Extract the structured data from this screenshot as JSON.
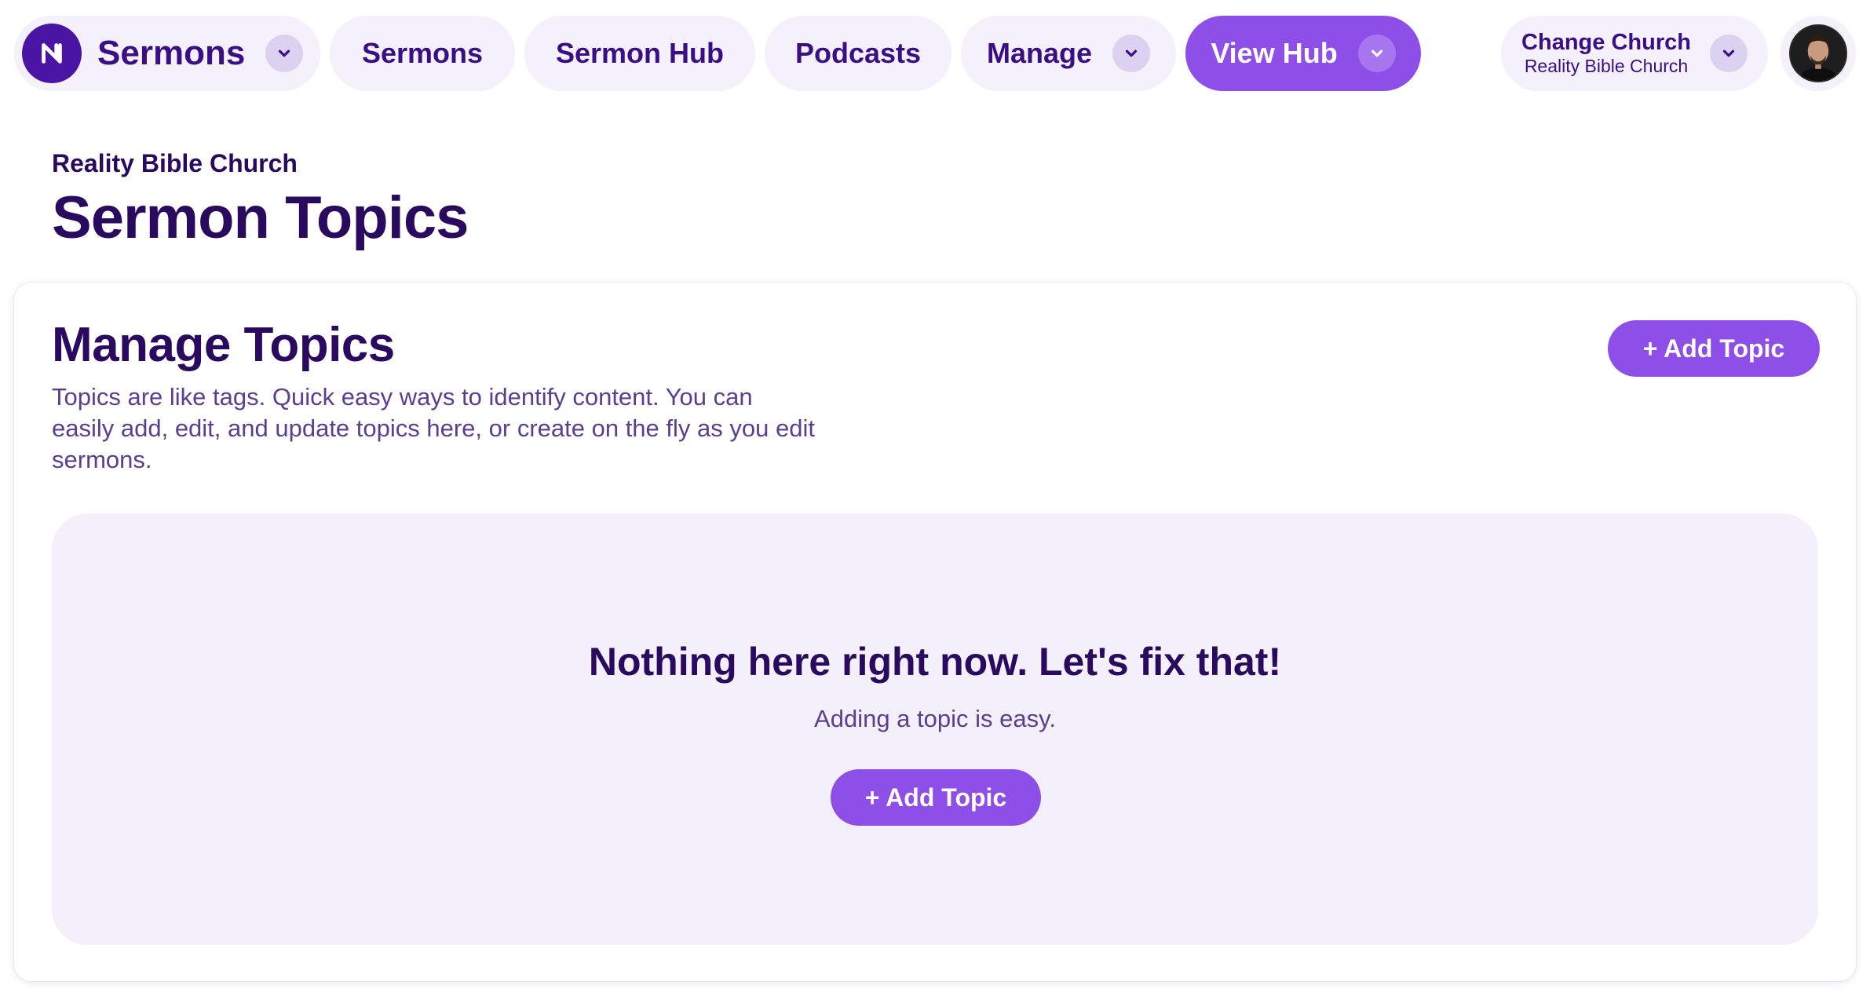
{
  "nav": {
    "brand_title": "Sermons",
    "items": [
      {
        "label": "Sermons"
      },
      {
        "label": "Sermon Hub"
      },
      {
        "label": "Podcasts"
      },
      {
        "label": "Manage"
      }
    ],
    "view_hub_label": "View Hub",
    "change_church": {
      "title": "Change Church",
      "subtitle": "Reality Bible Church"
    }
  },
  "header": {
    "church_name": "Reality Bible Church",
    "page_title": "Sermon Topics"
  },
  "card": {
    "title": "Manage Topics",
    "description": "Topics are like tags. Quick easy ways to identify content. You can easily add, edit, and update topics here, or create on the fly as you edit sermons.",
    "add_button": "+ Add Topic",
    "empty_state": {
      "title": "Nothing here right now. Let's fix that!",
      "subtitle": "Adding a topic is easy.",
      "button": "+ Add Topic"
    }
  },
  "icons": {
    "brand": "brand-logo-icon",
    "dropdown": "chevron-down-icon",
    "avatar": "user-avatar"
  },
  "colors": {
    "accent": "#8e4ee8",
    "brand_dark": "#4a14a5",
    "text_dark": "#2a0a5e",
    "pill_bg": "#f4f1fa",
    "empty_bg": "#f4f0fb"
  }
}
